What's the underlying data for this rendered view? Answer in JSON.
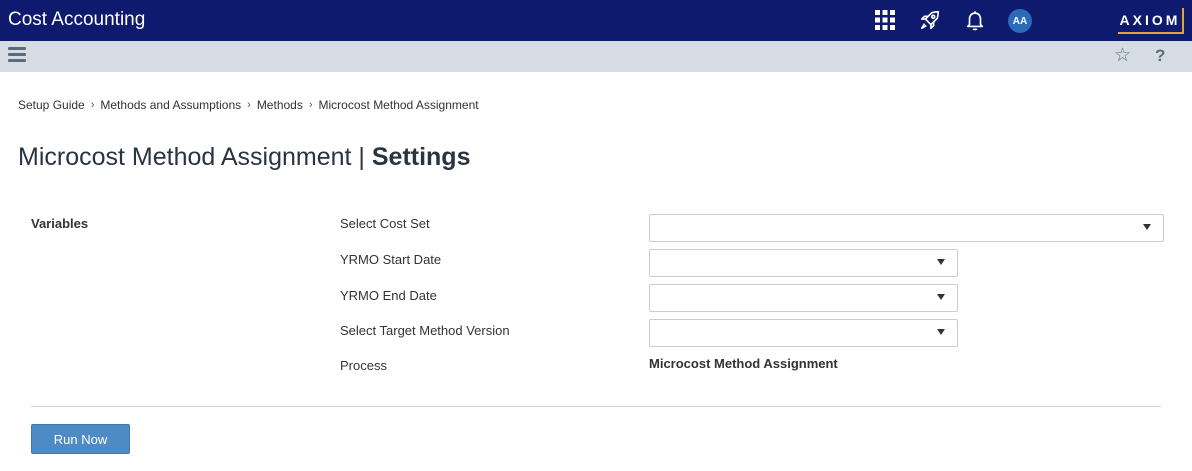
{
  "header": {
    "app_title": "Cost Accounting",
    "avatar_initials": "AA",
    "logo_text": "AXIOM",
    "icons": [
      "apps-grid-icon",
      "rocket-icon",
      "bell-icon"
    ]
  },
  "toolbar": {
    "menu_icon": "hamburger-icon",
    "favorite_icon": "star-icon",
    "help_label": "?"
  },
  "breadcrumb": [
    {
      "label": "Setup Guide"
    },
    {
      "label": "Methods and Assumptions"
    },
    {
      "label": "Methods"
    },
    {
      "label": "Microcost Method Assignment"
    }
  ],
  "breadcrumb_separator": "›",
  "page": {
    "title_main": "Microcost Method Assignment | ",
    "title_bold": "Settings"
  },
  "variables": {
    "section_label": "Variables",
    "fields": [
      {
        "label": "Select Cost Set",
        "value": ""
      },
      {
        "label": "YRMO Start Date",
        "value": ""
      },
      {
        "label": "YRMO End Date",
        "value": ""
      },
      {
        "label": "Select Target Method Version",
        "value": ""
      }
    ],
    "process_label": "Process",
    "process_value": "Microcost Method Assignment"
  },
  "actions": {
    "run_now_label": "Run Now"
  },
  "colors": {
    "topbar": "#0e1a6e",
    "subbar": "#d5dce3",
    "button": "#4e8bc4",
    "logo_accent": "#e8a03a"
  }
}
